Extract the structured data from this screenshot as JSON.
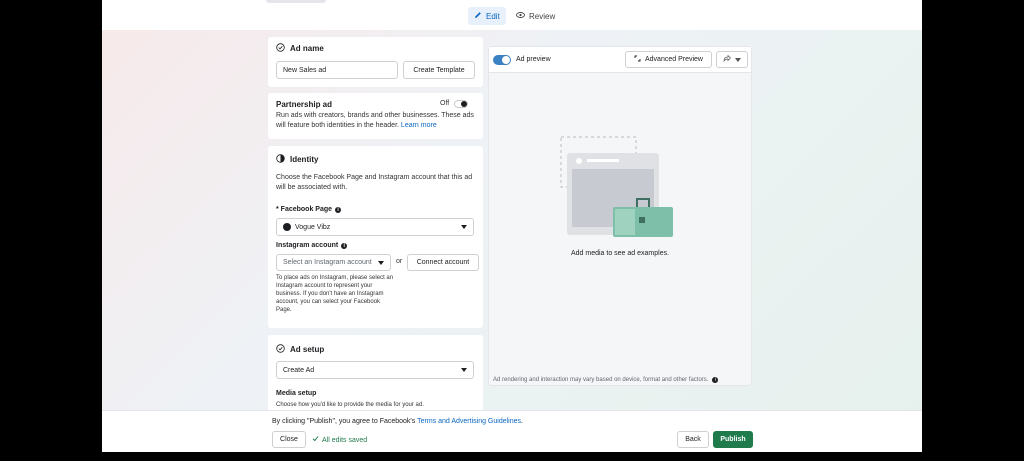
{
  "header": {
    "edit_tab": "Edit",
    "review_tab": "Review"
  },
  "ad_name": {
    "title": "Ad name",
    "value": "New Sales ad",
    "template_button": "Create Template"
  },
  "partnership": {
    "title": "Partnership ad",
    "toggle_label": "Off",
    "description": "Run ads with creators, brands and other businesses. These ads will feature both identities in the header.",
    "link": "Learn more"
  },
  "identity": {
    "title": "Identity",
    "description": "Choose the Facebook Page and Instagram account that this ad will be associated with.",
    "facebook_label": "* Facebook Page",
    "facebook_value": "Vogue Vibz",
    "instagram_label": "Instagram account",
    "instagram_placeholder": "Select an Instagram account",
    "or_text": "or",
    "connect_button": "Connect account",
    "help_text": "To place ads on Instagram, please select an Instagram account to represent your business. If you don't have an Instagram account, you can select your Facebook Page."
  },
  "ad_setup": {
    "title": "Ad setup",
    "format_value": "Create Ad",
    "media_label": "Media setup",
    "media_desc": "Choose how you'd like to provide the media for your ad."
  },
  "preview": {
    "toggle_label": "Ad preview",
    "advanced_button": "Advanced Preview",
    "empty_text": "Add media to see ad examples.",
    "disclaimer": "Ad rendering and interaction may vary based on device, format and other factors."
  },
  "footer": {
    "terms_prefix": "By clicking \"Publish\", you agree to Facebook's",
    "terms_link": "Terms and Advertising Guidelines",
    "terms_suffix": ".",
    "close": "Close",
    "saved": "All edits saved",
    "back": "Back",
    "publish": "Publish"
  },
  "colors": {
    "accent": "#0a66c2",
    "publish": "#1f7a4c",
    "saved": "#1f7a4c"
  }
}
